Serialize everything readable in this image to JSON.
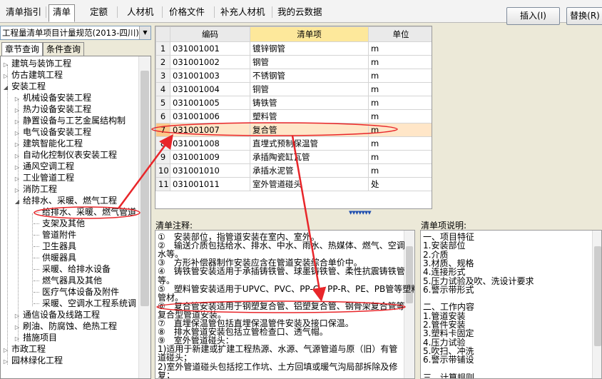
{
  "top_tabs": [
    "清单指引",
    "清单",
    "定额",
    "人材机",
    "价格文件",
    "补充人材机",
    "我的云数据"
  ],
  "buttons": {
    "insert": "插入(I)",
    "replace": "替换(R)"
  },
  "spec_select": "工程量清单项目计量规范(2013-四川)",
  "left_tabs": [
    "章节查询",
    "条件查询"
  ],
  "tree": [
    {
      "label": "建筑与装饰工程",
      "level": 1
    },
    {
      "label": "仿古建筑工程",
      "level": 1
    },
    {
      "label": "安装工程",
      "level": 1
    },
    {
      "label": "机械设备安装工程",
      "level": 2
    },
    {
      "label": "热力设备安装工程",
      "level": 2
    },
    {
      "label": "静置设备与工艺金属结构制",
      "level": 2
    },
    {
      "label": "电气设备安装工程",
      "level": 2
    },
    {
      "label": "建筑智能化工程",
      "level": 2
    },
    {
      "label": "自动化控制仪表安装工程",
      "level": 2
    },
    {
      "label": "通风空调工程",
      "level": 2
    },
    {
      "label": "工业管道工程",
      "level": 2
    },
    {
      "label": "消防工程",
      "level": 2
    },
    {
      "label": "给排水、采暖、燃气工程",
      "level": 2
    },
    {
      "label": "给排水、采暖、燃气管道",
      "level": 3
    },
    {
      "label": "支架及其他",
      "level": 3
    },
    {
      "label": "管道附件",
      "level": 3
    },
    {
      "label": "卫生器具",
      "level": 3
    },
    {
      "label": "供暖器具",
      "level": 3
    },
    {
      "label": "采暖、给排水设备",
      "level": 3
    },
    {
      "label": "燃气器具及其他",
      "level": 3
    },
    {
      "label": "医疗气体设备及附件",
      "level": 3
    },
    {
      "label": "采暖、空调水工程系统调",
      "level": 3
    },
    {
      "label": "通信设备及线路工程",
      "level": 2
    },
    {
      "label": "刷油、防腐蚀、绝热工程",
      "level": 2
    },
    {
      "label": "措施项目",
      "level": 2
    },
    {
      "label": "市政工程",
      "level": 1
    },
    {
      "label": "园林绿化工程",
      "level": 1
    }
  ],
  "grid": {
    "headers": [
      "",
      "编码",
      "清单项",
      "单位"
    ],
    "rows": [
      [
        "1",
        "031001001",
        "镀锌钢管",
        "m"
      ],
      [
        "2",
        "031001002",
        "钢管",
        "m"
      ],
      [
        "3",
        "031001003",
        "不锈钢管",
        "m"
      ],
      [
        "4",
        "031001004",
        "铜管",
        "m"
      ],
      [
        "5",
        "031001005",
        "铸铁管",
        "m"
      ],
      [
        "6",
        "031001006",
        "塑料管",
        "m"
      ],
      [
        "7",
        "031001007",
        "复合管",
        "m"
      ],
      [
        "8",
        "031001008",
        "直埋式预制保温管",
        "m"
      ],
      [
        "9",
        "031001009",
        "承插陶瓷缸瓦管",
        "m"
      ],
      [
        "10",
        "031001010",
        "承插水泥管",
        "m"
      ],
      [
        "11",
        "031001011",
        "室外管道碰头",
        "处"
      ]
    ]
  },
  "notes": {
    "label": "清单注释:",
    "lines": [
      "①　安装部位，指管道安装在室内、室外。",
      "②　输送介质包括给水、排水、中水、雨水、热媒体、燃气、空调",
      "水等。",
      "③　方形补偿器制作安装应含在管道安装综合单价中。",
      "④　铸铁管安装适用于承插铸铁管、球墨铸铁管、柔性抗震铸铁管",
      "等。",
      "⑤　塑料管安装适用于UPVC、PVC、PP-C、PP-R、PE、PB管等塑料",
      "管材。",
      "⑥　复合管安装适用于钢塑复合管、铝塑复合管、钢骨架复合管等",
      "复合型管道安装。",
      "⑦　直埋保温管包括直埋保温管件安装及接口保温。",
      "⑧　排水管道安装包括立管检查口、透气帽。",
      "⑨　室外管道碰头：",
      "1)适用于新建或扩建工程热源、水源、气源管道与原（旧）有管",
      "道碰头；",
      "2)室外管道碰头包括挖工作坑、土方回填或暖气沟局部拆除及修",
      "复；"
    ]
  },
  "description": {
    "label": "清单项说明:",
    "lines": [
      "一、项目特征",
      "1.安装部位",
      "2.介质",
      "3.材质、规格",
      "4.连接形式",
      "5.压力试验及吹、洗设计要求",
      "6.警示带形式",
      "",
      "二、工作内容",
      "1.管道安装",
      "2.管件安装",
      "3.塑料卡固定",
      "4.压力试验",
      "5.吹扫、冲洗",
      "6.警示带铺设",
      "",
      "三、计算规则"
    ]
  },
  "annotation_color": "#e8262a"
}
